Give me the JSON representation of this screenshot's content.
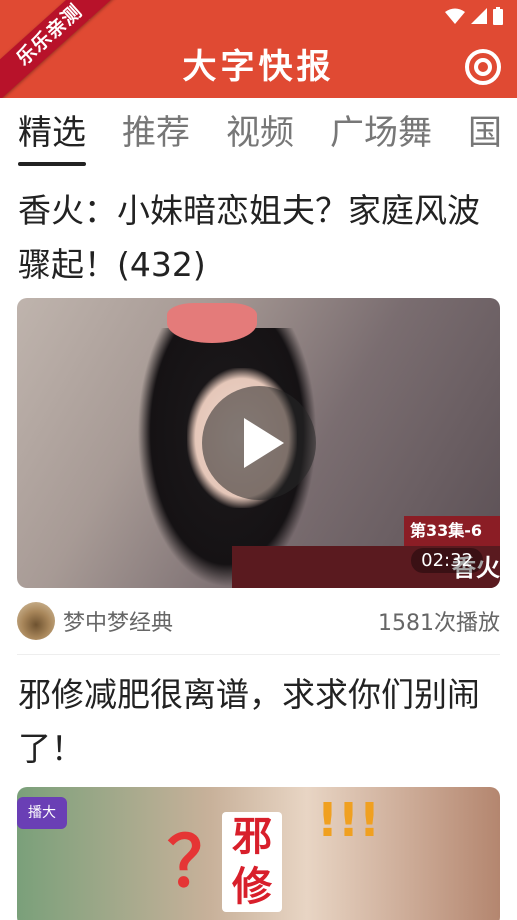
{
  "ribbon_text": "乐乐亲测",
  "app_title": "大字快报",
  "tabs": [
    "精选",
    "推荐",
    "视频",
    "广场舞",
    "国"
  ],
  "active_tab": 0,
  "articles": [
    {
      "title": "香火：小妹暗恋姐夫？家庭风波骤起！(432)",
      "thumbnail_badge": "第33集-6",
      "thumbnail_corner_text": "香火",
      "duration": "02:32",
      "author": "梦中梦经典",
      "plays": "1581次播放"
    },
    {
      "title": "邪修减肥很离谱，求求你们别闹了！",
      "thumbnail_badge": "播大",
      "thumbnail_text": "邪修",
      "thumbnail_mark": "？",
      "thumbnail_exclaim": "!!!"
    }
  ],
  "colors": {
    "header_bg": "#e04a33",
    "ribbon_bg": "#b8122a",
    "active_tab": "#222222",
    "inactive_tab": "#777777"
  },
  "icons": {
    "wifi": "wifi-icon",
    "signal": "signal-icon",
    "battery": "battery-icon",
    "settings": "target-icon",
    "play": "play-icon"
  }
}
